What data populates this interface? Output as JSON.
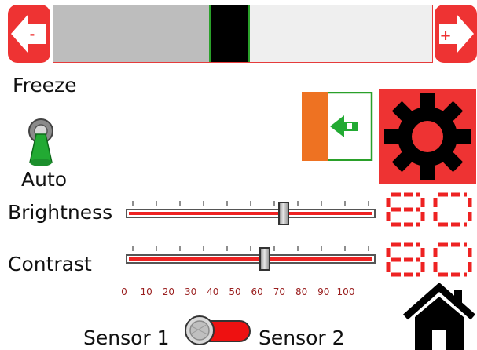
{
  "freeze": {
    "label": "Freeze",
    "minus_label": "-",
    "plus_label": "+",
    "fill_fraction": 0.41,
    "thumb_fraction": 0.41
  },
  "mode": {
    "label": "Auto"
  },
  "brightness": {
    "label": "Brightness",
    "value": 64
  },
  "contrast": {
    "label": "Contrast",
    "value": 56
  },
  "scale": {
    "ticks": [
      "0",
      "10",
      "20",
      "30",
      "40",
      "50",
      "60",
      "70",
      "80",
      "90",
      "100"
    ]
  },
  "sensor": {
    "left_label": "Sensor 1",
    "right_label": "Sensor 2"
  },
  "colors": {
    "accent_red": "#ee3333",
    "green": "#2aa02a",
    "orange": "#ee7222",
    "scale_text": "#9a1f1f"
  },
  "icons": {
    "minus_button": "arrow-left-icon",
    "plus_button": "arrow-right-icon",
    "exit": "exit-door-icon",
    "settings": "gear-icon",
    "home": "home-icon",
    "toggle": "toggle-lever-icon"
  }
}
